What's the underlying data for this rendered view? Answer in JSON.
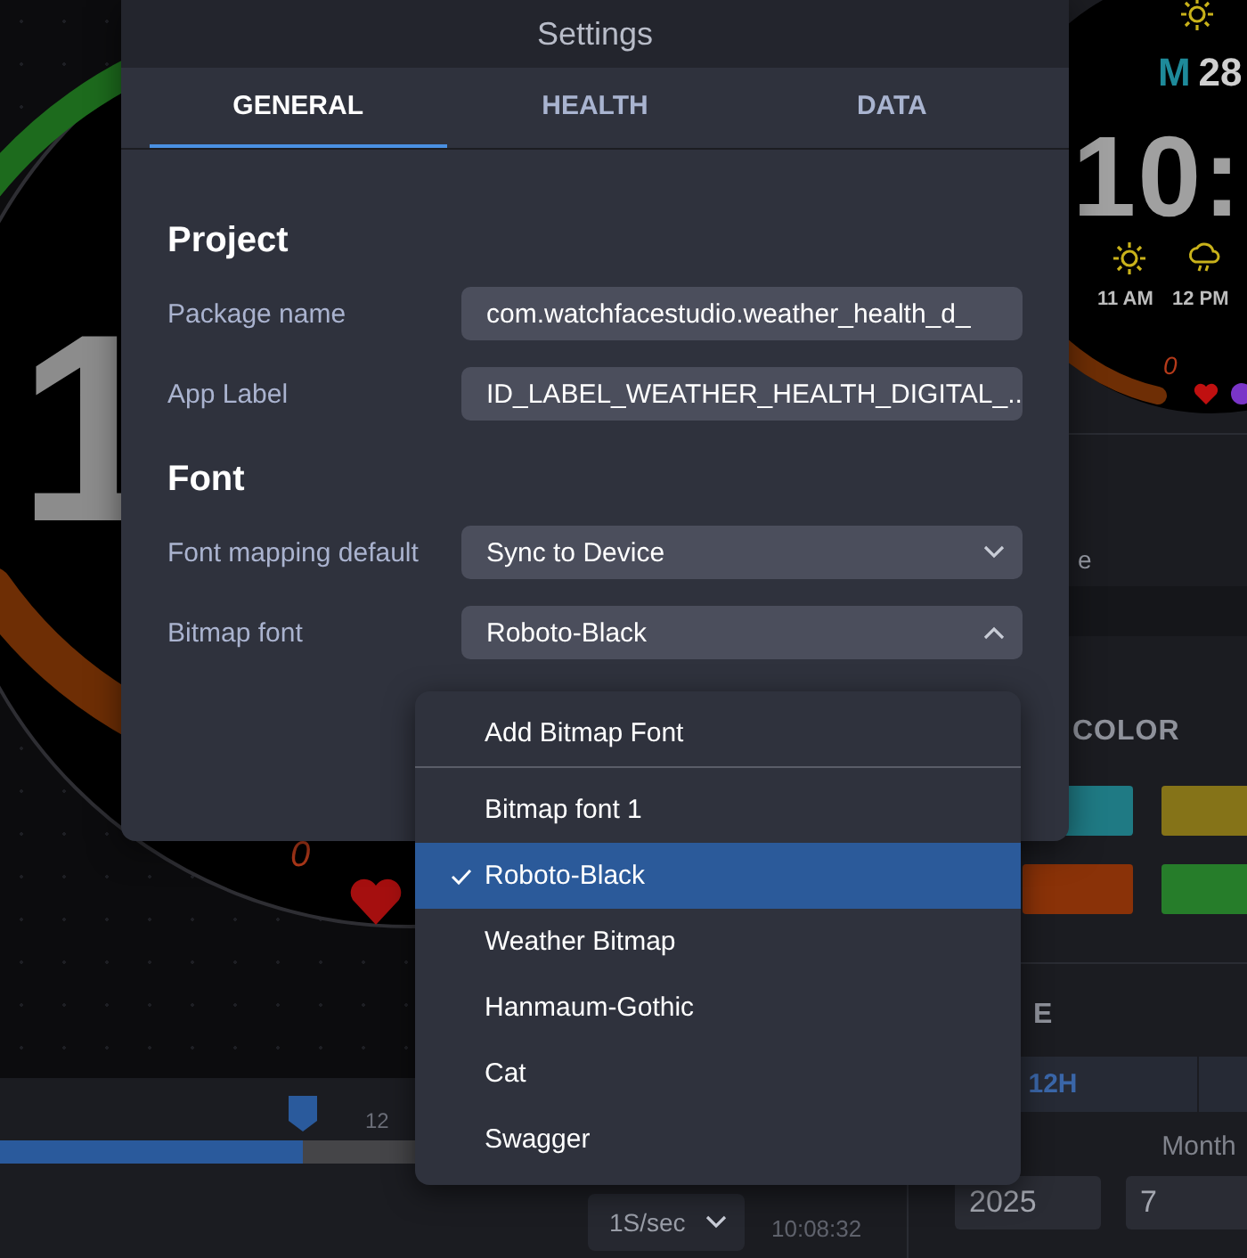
{
  "canvas": {
    "digit": "1",
    "gauge_value": "0"
  },
  "timeline": {
    "level": 0.34,
    "tick": "12",
    "speed": "1S/sec",
    "time": "10:08:32"
  },
  "preview": {
    "day": "M",
    "date": "28",
    "time": "10:",
    "forecast": [
      {
        "kind": "sun",
        "time": "11 AM"
      },
      {
        "kind": "rain",
        "time": "12 PM"
      }
    ],
    "gauge_value": "0"
  },
  "side_panel": {
    "partial_label": "e",
    "color_heading": "COLOR",
    "swatches": [
      {
        "color": "#1f7a84"
      },
      {
        "color": "#857318"
      },
      {
        "color": "#8a3208"
      },
      {
        "color": "#267d2a"
      }
    ],
    "partial_heading": "E",
    "time_format": [
      {
        "label": "12H",
        "selected": true
      }
    ],
    "date_fields": [
      {
        "value": "2025"
      },
      {
        "label": "Month",
        "value": "7"
      }
    ]
  },
  "dialog": {
    "title": "Settings",
    "tabs": [
      {
        "label": "GENERAL",
        "selected": true
      },
      {
        "label": "HEALTH",
        "selected": false
      },
      {
        "label": "DATA",
        "selected": false
      }
    ],
    "sections": [
      {
        "heading": "Project",
        "fields": [
          {
            "kind": "text",
            "label": "Package name",
            "value": "com.watchfacestudio.weather_health_d_"
          },
          {
            "kind": "text",
            "label": "App Label",
            "value": "ID_LABEL_WEATHER_HEALTH_DIGITAL_..."
          }
        ]
      },
      {
        "heading": "Font",
        "fields": [
          {
            "kind": "select",
            "label": "Font mapping default",
            "value": "Sync to Device",
            "expanded": false
          },
          {
            "kind": "select",
            "label": "Bitmap font",
            "value": "Roboto-Black",
            "expanded": true
          }
        ]
      }
    ]
  },
  "dropdown_menu": {
    "items": [
      {
        "kind": "action",
        "label": "Add Bitmap Font"
      },
      {
        "kind": "option",
        "label": "Bitmap font 1",
        "selected": false
      },
      {
        "kind": "option",
        "label": "Roboto-Black",
        "selected": true
      },
      {
        "kind": "option",
        "label": "Weather Bitmap",
        "selected": false
      },
      {
        "kind": "option",
        "label": "Hanmaum-Gothic",
        "selected": false
      },
      {
        "kind": "option",
        "label": "Cat",
        "selected": false
      },
      {
        "kind": "option",
        "label": "Swagger",
        "selected": false
      }
    ]
  }
}
